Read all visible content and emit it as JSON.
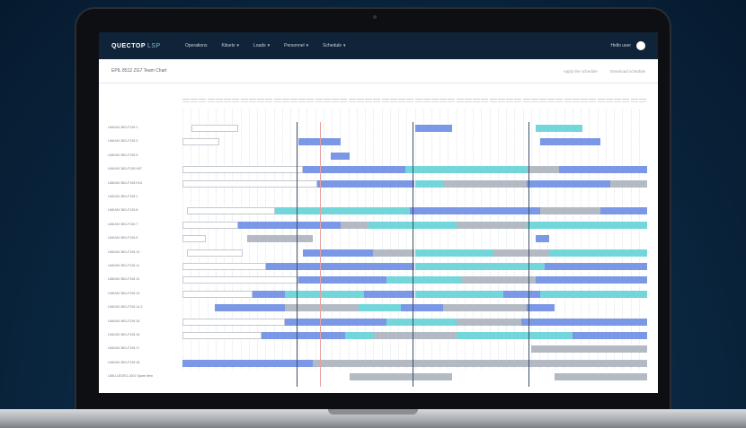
{
  "brand": {
    "name": "QUECTOP",
    "suffix": "LSP"
  },
  "nav": {
    "items": [
      "Operations",
      "Kitsets",
      "Loads",
      "Personnel",
      "Schedule"
    ]
  },
  "user": {
    "name": "Hello user"
  },
  "page": {
    "title": "EPIL 8512 ZG7 Team Chart",
    "links": [
      "Apply the schedule",
      "Download schedule"
    ]
  },
  "colors": {
    "nav_bg": "#0f2438",
    "grey": "#b3bac3",
    "blue": "#7b98e6",
    "teal": "#73d6da",
    "marker_dark": "#3d4f63",
    "marker_red": "#e9a0a0"
  },
  "rows": [
    "LIMUUX B01-F126 1",
    "LIMUUX B01-F126 3",
    "LIMUUX B01-F126 9",
    "LIMUUX B01-F126 H07",
    "LIMUUX B01-F126 H13",
    "LIMUUX B01-F126 1",
    "LIMUUX B01-F126 8",
    "LIMUUX B01-F126 7",
    "LIMUUX B01-F126 5",
    "LIMUUX B01-F126 10",
    "LIMUUX B01-F126 11",
    "LIMUUX B01-F126 12",
    "LIMUUX B01-F126 13",
    "LIMUUX B01-F126 14-2",
    "LIMUUX B01-F126 15",
    "LIMUUX B01-F126 16",
    "LIMUUX B01-F126 17",
    "LIMUUX B01-F126 18",
    "LIMU-LEGEO-1001 Spare Item"
  ]
}
